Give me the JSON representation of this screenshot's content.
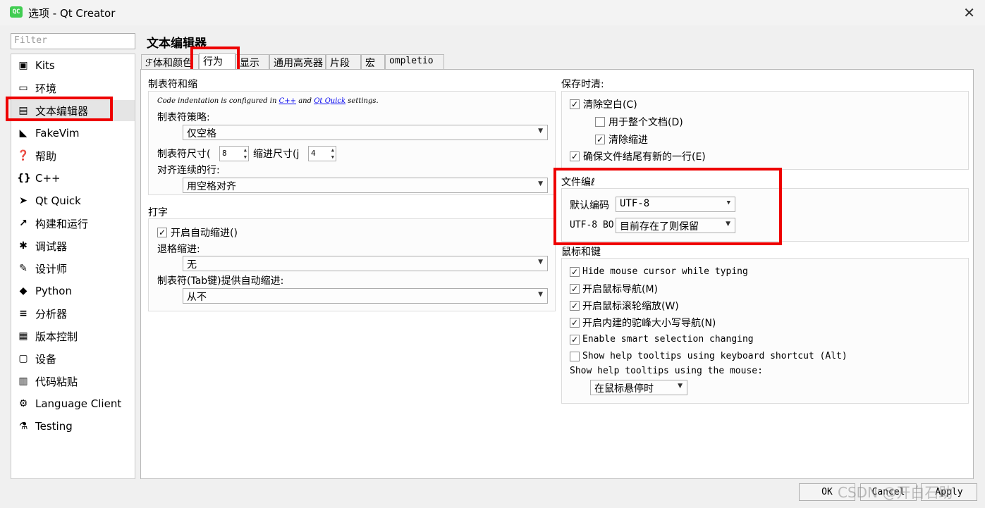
{
  "window": {
    "title": "选项 - Qt Creator",
    "icon_text": "QC",
    "close_glyph": "✕"
  },
  "filter": {
    "placeholder": "Filter"
  },
  "sidebar": {
    "items": [
      {
        "label": "Kits",
        "icon": "kits-icon",
        "glyph": "▣"
      },
      {
        "label": "环境",
        "icon": "monitor-icon",
        "glyph": "▭"
      },
      {
        "label": "文本编辑器",
        "icon": "text-editor-icon",
        "glyph": "▤"
      },
      {
        "label": "FakeVim",
        "icon": "fakevim-icon",
        "glyph": "◣"
      },
      {
        "label": "帮助",
        "icon": "help-icon",
        "glyph": "❓"
      },
      {
        "label": "C++",
        "icon": "braces-icon",
        "glyph": "{}"
      },
      {
        "label": "Qt Quick",
        "icon": "qtquick-icon",
        "glyph": "➤"
      },
      {
        "label": "构建和运行",
        "icon": "hammer-icon",
        "glyph": "↗"
      },
      {
        "label": "调试器",
        "icon": "bug-icon",
        "glyph": "✱"
      },
      {
        "label": "设计师",
        "icon": "pen-icon",
        "glyph": "✎"
      },
      {
        "label": "Python",
        "icon": "python-icon",
        "glyph": "◆"
      },
      {
        "label": "分析器",
        "icon": "analyzer-icon",
        "glyph": "≡"
      },
      {
        "label": "版本控制",
        "icon": "version-control-icon",
        "glyph": "▦"
      },
      {
        "label": "设备",
        "icon": "device-icon",
        "glyph": "▢"
      },
      {
        "label": "代码粘贴",
        "icon": "paste-icon",
        "glyph": "▥"
      },
      {
        "label": "Language Client",
        "icon": "language-client-icon",
        "glyph": "⚙"
      },
      {
        "label": "Testing",
        "icon": "testing-icon",
        "glyph": "⚗"
      }
    ],
    "selected_index": 2
  },
  "page": {
    "title": "文本编辑器"
  },
  "tabs": [
    {
      "label": "字体和颜色"
    },
    {
      "label": "行为"
    },
    {
      "label": "显示"
    },
    {
      "label": "通用高亮器"
    },
    {
      "label": "片段"
    },
    {
      "label": "宏"
    },
    {
      "label": "ompletio"
    }
  ],
  "tabs_cut": "ℱ体和颜色",
  "tabs_cut2": "通用高亮器",
  "tabs_display": [
    "ℱ体和颜色",
    "行为",
    "显示",
    "通用高亮器",
    "片段",
    "宏",
    "ompletio"
  ],
  "indent": {
    "title": "制表符和缩",
    "note_prefix": "Code indentation is configured in ",
    "note_link1": "C++",
    "note_mid": " and ",
    "note_link2": "Qt Quick",
    "note_suffix": " settings.",
    "policy_label": "制表符策略:",
    "policy_value": "仅空格",
    "tab_size_label": "制表符尺寸(",
    "tab_size_value": "8",
    "indent_size_label": "缩进尺寸(j",
    "indent_size_value": "4",
    "align_label": "对齐连续的行:",
    "align_value": "用空格对齐"
  },
  "typing": {
    "title": "打字",
    "auto_indent_label": "开启自动缩进()",
    "auto_indent_checked": true,
    "backspace_label": "退格缩进:",
    "backspace_value": "无",
    "tab_key_label": "制表符(Tab键)提供自动缩进:",
    "tab_key_value": "从不"
  },
  "cleanup": {
    "title": "保存时清:",
    "items": [
      {
        "label": "清除空白(C)",
        "checked": true
      },
      {
        "label": "用于整个文档(D)",
        "checked": false
      },
      {
        "label": "清除缩进",
        "checked": true
      },
      {
        "label": "确保文件结尾有新的一行(E)",
        "checked": true
      }
    ]
  },
  "encoding": {
    "title": "文件编ℓ",
    "default_label": "默认编码",
    "default_value": "UTF-8",
    "bom_label": "UTF-8 BO",
    "bom_value": "目前存在了则保留"
  },
  "mouse": {
    "title": "鼠标和键",
    "items": [
      {
        "label": "Hide mouse cursor while typing",
        "checked": true
      },
      {
        "label": "开启鼠标导航(M)",
        "checked": true
      },
      {
        "label": "开启鼠标滚轮缩放(W)",
        "checked": true
      },
      {
        "label": "开启内建的驼峰大小写导航(N)",
        "checked": true
      },
      {
        "label": "Enable smart selection changing",
        "checked": true
      },
      {
        "label": "Show help tooltips using keyboard shortcut (Alt)",
        "checked": false
      }
    ],
    "tooltip_label": "Show help tooltips using the mouse:",
    "tooltip_value": "在鼠标悬停时"
  },
  "buttons": {
    "ok": "OK",
    "cancel": "Cancel",
    "apply": "Apply"
  },
  "watermark": "CSDN @开白石助",
  "highlight_color": "#e00000"
}
